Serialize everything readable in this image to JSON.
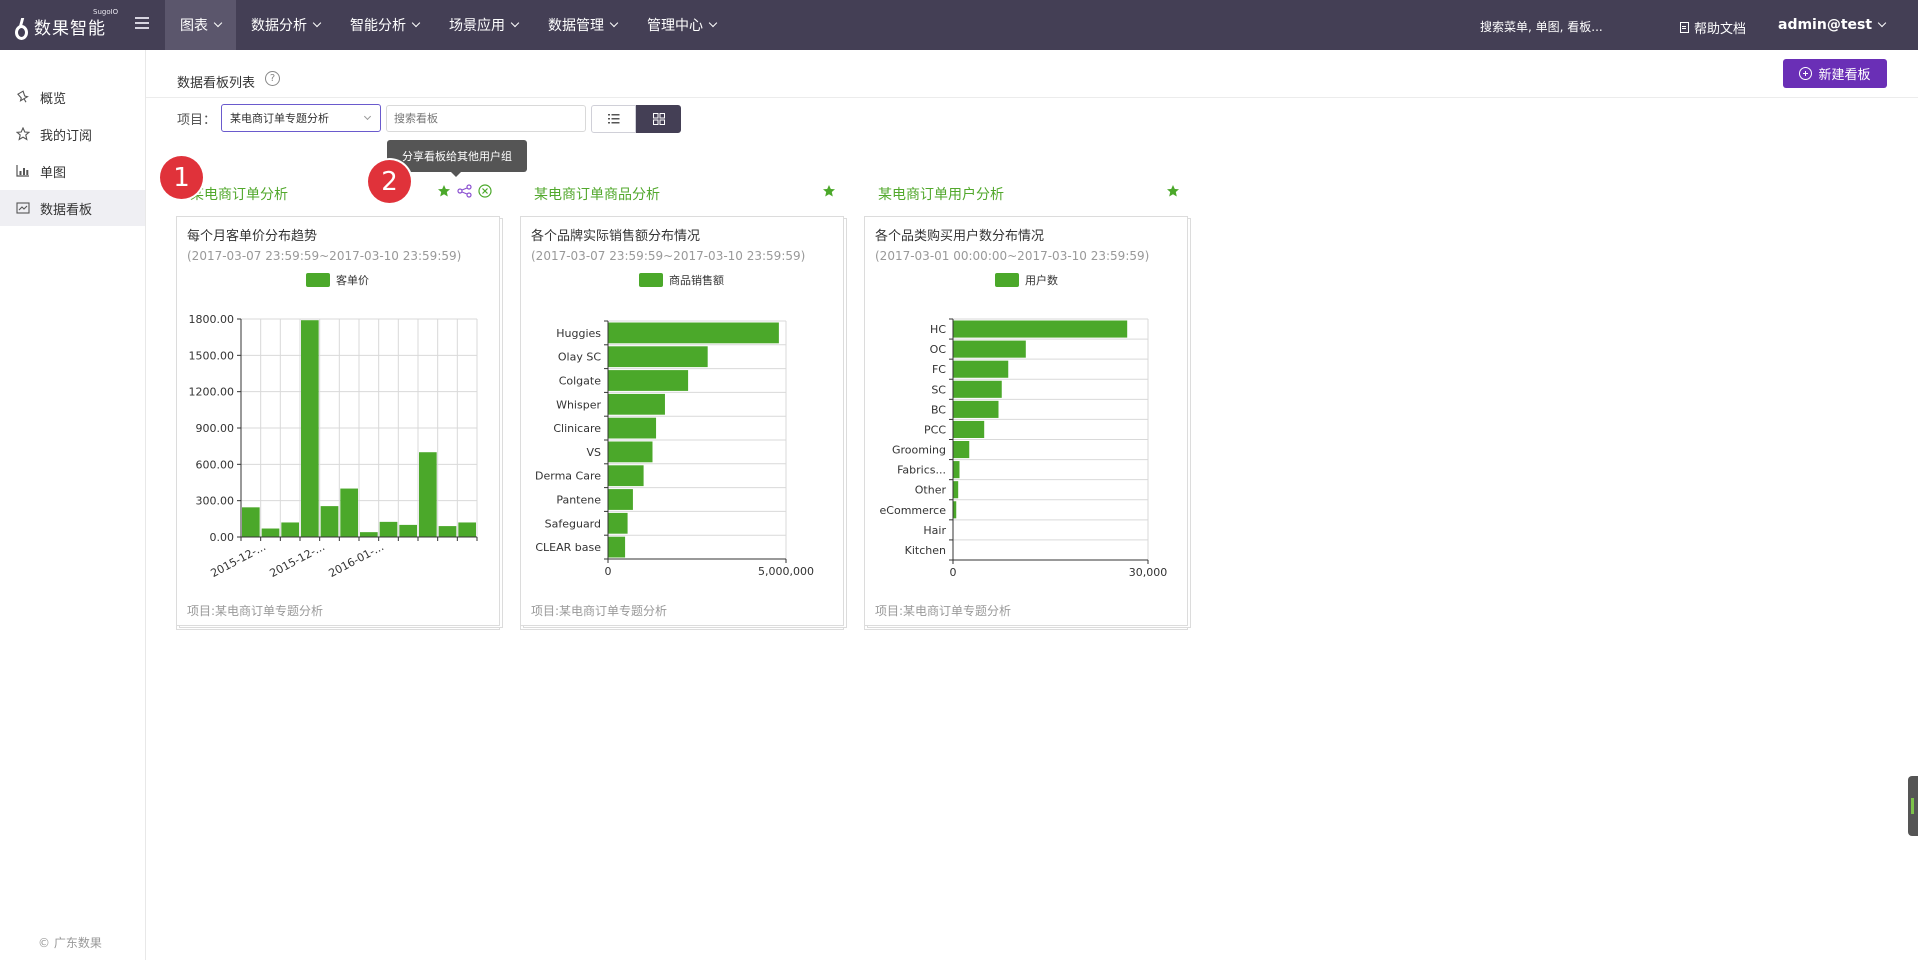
{
  "brand": {
    "name": "数果智能",
    "sup": "SugoIO"
  },
  "nav": [
    {
      "label": "图表",
      "active": true
    },
    {
      "label": "数据分析",
      "active": false
    },
    {
      "label": "智能分析",
      "active": false
    },
    {
      "label": "场景应用",
      "active": false
    },
    {
      "label": "数据管理",
      "active": false
    },
    {
      "label": "管理中心",
      "active": false
    }
  ],
  "top_search": "搜索菜单, 单图, 看板...",
  "help_label": "帮助文档",
  "user_label": "admin@test",
  "sidebar": {
    "items": [
      {
        "label": "概览",
        "icon": "pin-icon",
        "active": false
      },
      {
        "label": "我的订阅",
        "icon": "star-outline-icon",
        "active": false
      },
      {
        "label": "单图",
        "icon": "chart-icon",
        "active": false
      },
      {
        "label": "数据看板",
        "icon": "dashboard-icon",
        "active": true
      }
    ],
    "copyright": "© 广东数果"
  },
  "page": {
    "title": "数据看板列表",
    "help_icon": "?",
    "new_button": "新建看板",
    "project_label": "项目：",
    "project_value": "某电商订单专题分析",
    "search_placeholder": "搜索看板",
    "tooltip": "分享看板给其他用户组",
    "markers": [
      "1",
      "2"
    ]
  },
  "colors": {
    "accent": "#6a2fb6",
    "nav_bg": "#443f55",
    "bar": "#4ba82a",
    "title_green": "#52a82c",
    "marker": "#e0323a"
  },
  "boards": [
    {
      "title": "某电商订单分析",
      "chart_title": "每个月客单价分布趋势",
      "date_range": "(2017-03-07 23:59:59~2017-03-10 23:59:59)",
      "legend": "客单价",
      "project": "项目:某电商订单专题分析"
    },
    {
      "title": "某电商订单商品分析",
      "chart_title": "各个品牌实际销售额分布情况",
      "date_range": "(2017-03-07 23:59:59~2017-03-10 23:59:59)",
      "legend": "商品销售额",
      "project": "项目:某电商订单专题分析"
    },
    {
      "title": "某电商订单用户分析",
      "chart_title": "各个品类购买用户数分布情况",
      "date_range": "(2017-03-01 00:00:00~2017-03-10 23:59:59)",
      "legend": "用户数",
      "project": "项目:某电商订单专题分析"
    }
  ],
  "chart_data": [
    {
      "type": "bar",
      "orientation": "vertical",
      "series": [
        {
          "name": "客单价",
          "values": [
            245,
            70,
            120,
            1790,
            255,
            400,
            40,
            125,
            100,
            700,
            90,
            120
          ]
        }
      ],
      "yticks": [
        "0.00",
        "300.00",
        "600.00",
        "900.00",
        "1200.00",
        "1500.00",
        "1800.00"
      ],
      "ylim": [
        0,
        1800
      ],
      "xtick_labels": [
        "2015-12-...",
        "2015-12-...",
        "2016-01-..."
      ],
      "grid": true
    },
    {
      "type": "bar",
      "orientation": "horizontal",
      "categories": [
        "Huggies",
        "Olay SC",
        "Colgate",
        "Whisper",
        "Clinicare",
        "VS",
        "Derma Care",
        "Pantene",
        "Safeguard",
        "CLEAR base"
      ],
      "series": [
        {
          "name": "商品销售额",
          "values": [
            4800000,
            2800000,
            2250000,
            1600000,
            1350000,
            1250000,
            1000000,
            700000,
            550000,
            480000
          ]
        }
      ],
      "xlim": [
        0,
        5000000
      ],
      "xtick_labels": [
        "0",
        "5,000,000"
      ],
      "grid": true
    },
    {
      "type": "bar",
      "orientation": "horizontal",
      "categories": [
        "HC",
        "OC",
        "FC",
        "SC",
        "BC",
        "PCC",
        "Grooming",
        "Fabrics...",
        "Other",
        "eCommerce",
        "Hair",
        "Kitchen"
      ],
      "series": [
        {
          "name": "用户数",
          "values": [
            26800,
            11200,
            8500,
            7500,
            7000,
            4800,
            2500,
            1000,
            800,
            500,
            0,
            0
          ]
        }
      ],
      "xlim": [
        0,
        30000
      ],
      "xtick_labels": [
        "0",
        "30,000"
      ],
      "grid": true
    }
  ]
}
